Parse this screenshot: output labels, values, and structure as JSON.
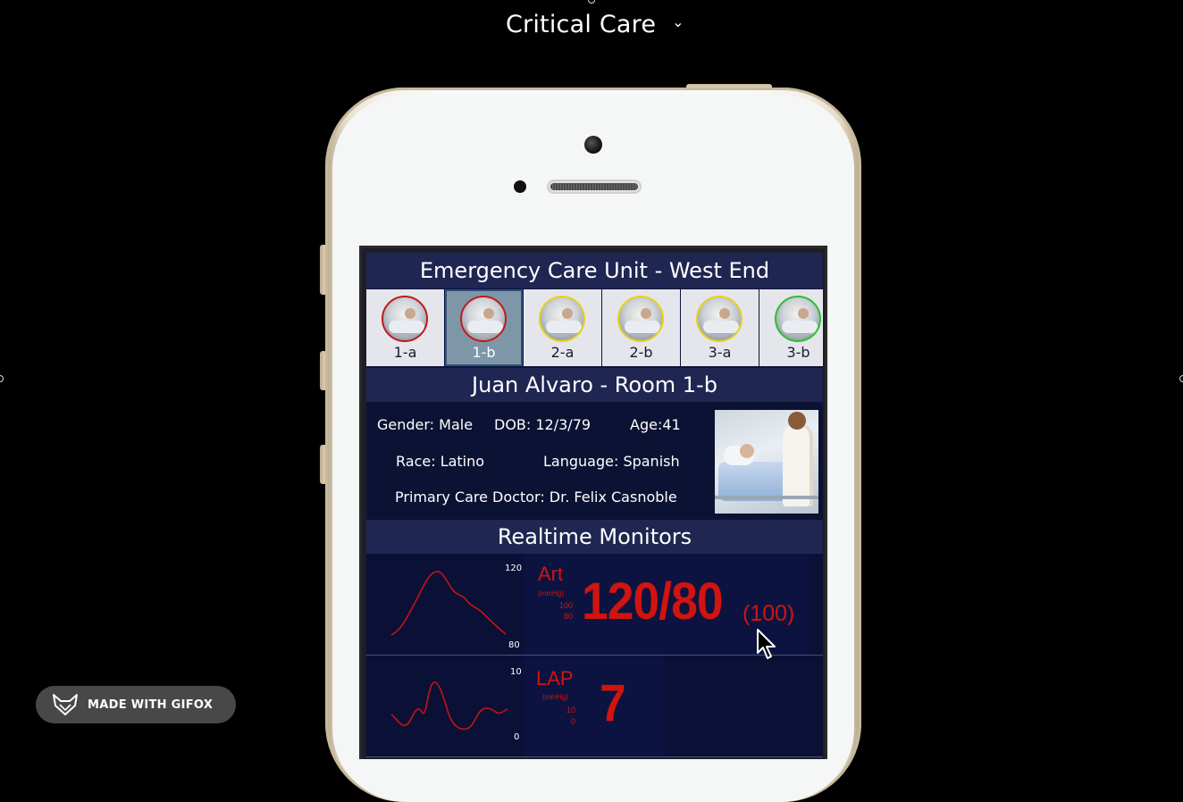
{
  "app": {
    "title": "Critical Care"
  },
  "screen": {
    "unit_title": "Emergency Care Unit - West End",
    "rooms": [
      {
        "label": "1-a",
        "status_color": "#c21a1a",
        "selected": false
      },
      {
        "label": "1-b",
        "status_color": "#c21a1a",
        "selected": true
      },
      {
        "label": "2-a",
        "status_color": "#e8d21a",
        "selected": false
      },
      {
        "label": "2-b",
        "status_color": "#e8d21a",
        "selected": false
      },
      {
        "label": "3-a",
        "status_color": "#e8d21a",
        "selected": false
      },
      {
        "label": "3-b",
        "status_color": "#2fbf2f",
        "selected": false
      }
    ],
    "patient": {
      "header": "Juan Alvaro - Room 1-b",
      "gender": "Gender: Male",
      "dob": "DOB: 12/3/79",
      "age": "Age:41",
      "race": "Race: Latino",
      "language": "Language: Spanish",
      "doctor": "Primary Care Doctor: Dr. Felix Casnoble"
    },
    "monitors_title": "Realtime Monitors",
    "monitors": [
      {
        "name": "Art",
        "unit": "(mmHg)",
        "limit_high": "100",
        "limit_low": "80",
        "value": "120/80",
        "mean": "(100)",
        "scale_top": "120",
        "scale_bottom": "80"
      },
      {
        "name": "LAP",
        "unit": "(mmHg)",
        "limit_high": "10",
        "limit_low": "0",
        "value": "7",
        "scale_top": "10",
        "scale_bottom": "0"
      }
    ]
  },
  "watermark": {
    "text": "MADE WITH GIFOX"
  },
  "colors": {
    "alarm_red": "#d0140f",
    "header_navy": "#1f2652"
  }
}
